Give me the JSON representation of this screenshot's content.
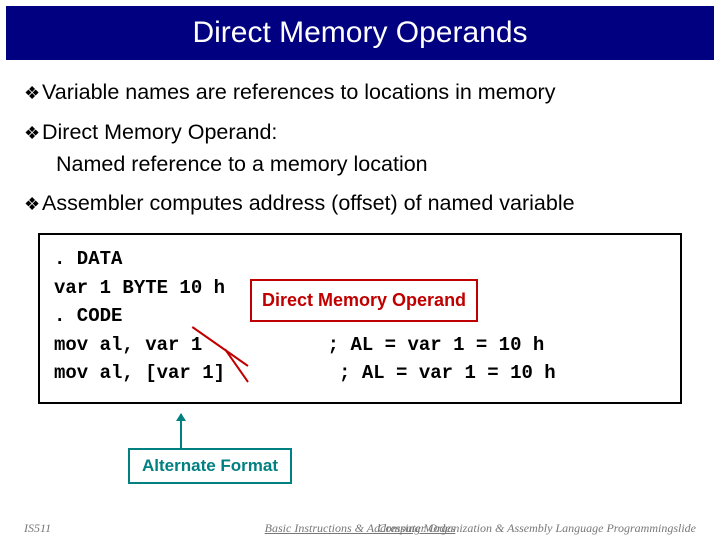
{
  "title": "Direct Memory Operands",
  "bullets": {
    "b1": "Variable names are references to locations in memory",
    "b2": "Direct Memory Operand:",
    "b2_sub": "Named reference to a memory location",
    "b3": "Assembler computes address (offset) of named variable"
  },
  "code": {
    "l1": ". DATA",
    "l2": "var 1 BYTE 10 h",
    "l3": ". CODE",
    "l4": "mov al, var 1           ; AL = var 1 = 10 h",
    "l5": "mov al, [var 1]          ; AL = var 1 = 10 h"
  },
  "labels": {
    "dmo": "Direct Memory Operand",
    "alt": "Alternate Format"
  },
  "footer": {
    "left": "IS511",
    "center": "Basic Instructions & Addressing Modes",
    "right": "Computer Organization & Assembly Language Programmingslide"
  }
}
